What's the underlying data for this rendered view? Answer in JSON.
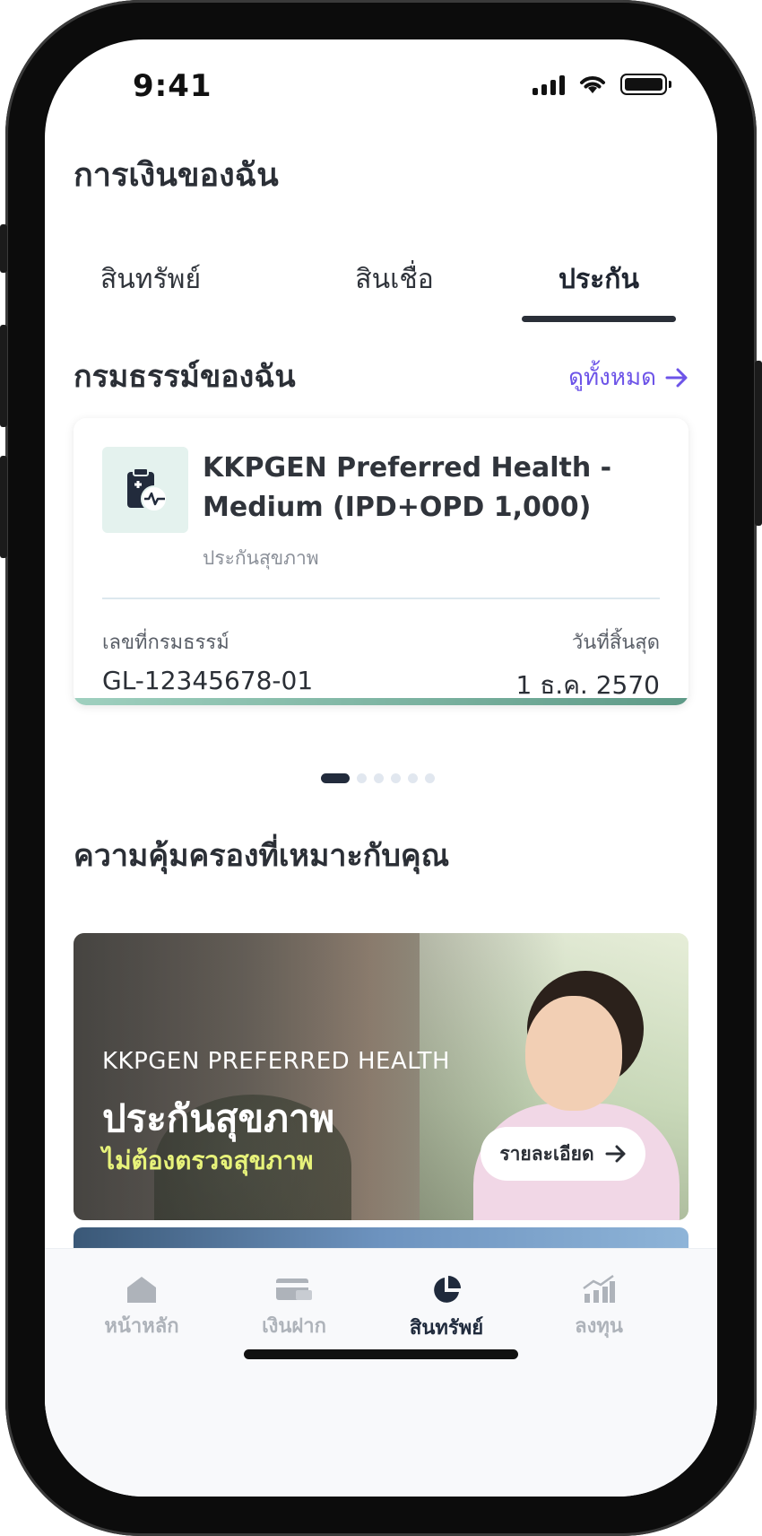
{
  "status_bar": {
    "time": "9:41"
  },
  "page": {
    "title": "การเงินของฉัน"
  },
  "tabs": [
    {
      "label": "สินทรัพย์",
      "active": false
    },
    {
      "label": "สินเชื่อ",
      "active": false
    },
    {
      "label": "ประกัน",
      "active": true
    }
  ],
  "policies_section": {
    "title": "กรมธรรม์ของฉัน",
    "see_all": "ดูทั้งหมด",
    "policy": {
      "icon": "health-clipboard-icon",
      "name": "KKPGEN Preferred Health - Medium (IPD+OPD 1,000)",
      "type": "ประกันสุขภาพ",
      "number_label": "เลขที่กรมธรรม์",
      "number": "GL-12345678-01",
      "end_label": "วันที่สิ้นสุด",
      "end_date": "1 ธ.ค. 2570"
    }
  },
  "recommend_section": {
    "title": "ความคุ้มครองที่เหมาะกับคุณ",
    "banner": {
      "kicker": "KKPGEN PREFERRED HEALTH",
      "title": "ประกันสุขภาพ",
      "subtitle": "ไม่ต้องตรวจสุขภาพ",
      "button": "รายละเอียด"
    }
  },
  "bottom_nav": [
    {
      "label": "หน้าหลัก",
      "icon": "home-icon",
      "active": false
    },
    {
      "label": "เงินฝาก",
      "icon": "card-icon",
      "active": false
    },
    {
      "label": "สินทรัพย์",
      "icon": "pie-chart-icon",
      "active": true
    },
    {
      "label": "ลงทุน",
      "icon": "growth-chart-icon",
      "active": false
    }
  ],
  "colors": {
    "accent": "#6d54e8",
    "primary_dark": "#222b3c",
    "banner_highlight": "#e7f27a"
  }
}
